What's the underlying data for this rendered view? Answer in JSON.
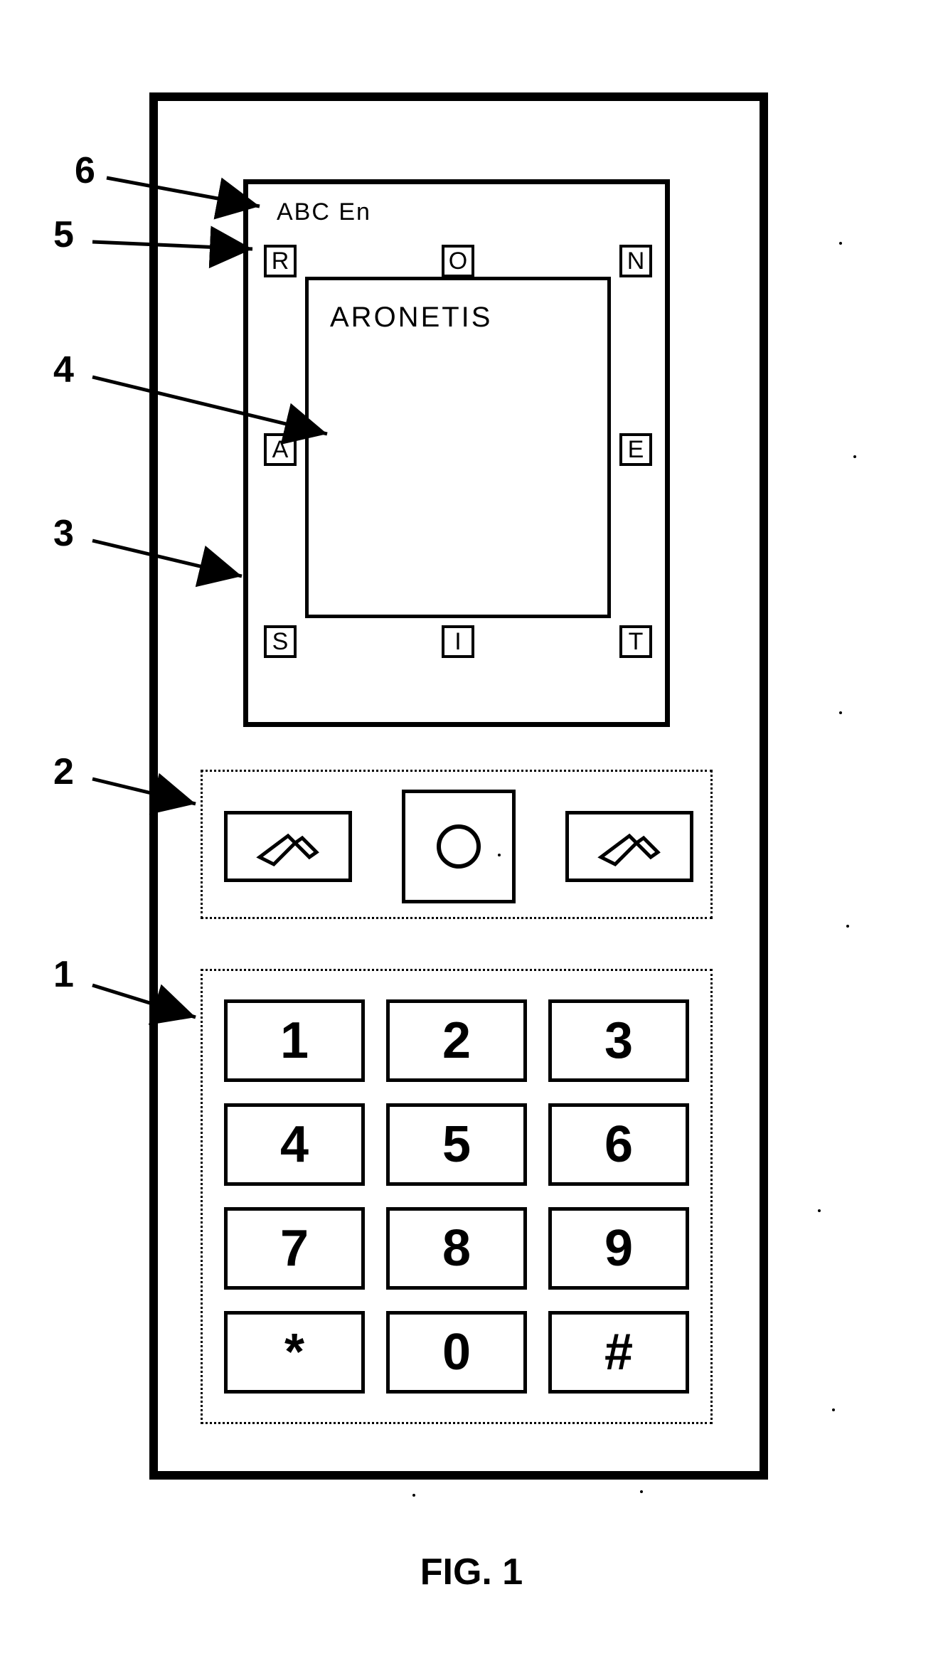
{
  "figure_caption": "FIG. 1",
  "screen": {
    "mode": "ABC   En",
    "inner_text": "ARONETIS",
    "letters": {
      "top_left": "R",
      "top_mid": "O",
      "top_right": "N",
      "mid_left": "A",
      "mid_right": "E",
      "bot_left": "S",
      "bot_mid": "I",
      "bot_right": "T"
    }
  },
  "keypad": [
    "1",
    "2",
    "3",
    "4",
    "5",
    "6",
    "7",
    "8",
    "9",
    "*",
    "0",
    "#"
  ],
  "callouts": {
    "c1": "1",
    "c2": "2",
    "c3": "3",
    "c4": "4",
    "c5": "5",
    "c6": "6"
  }
}
